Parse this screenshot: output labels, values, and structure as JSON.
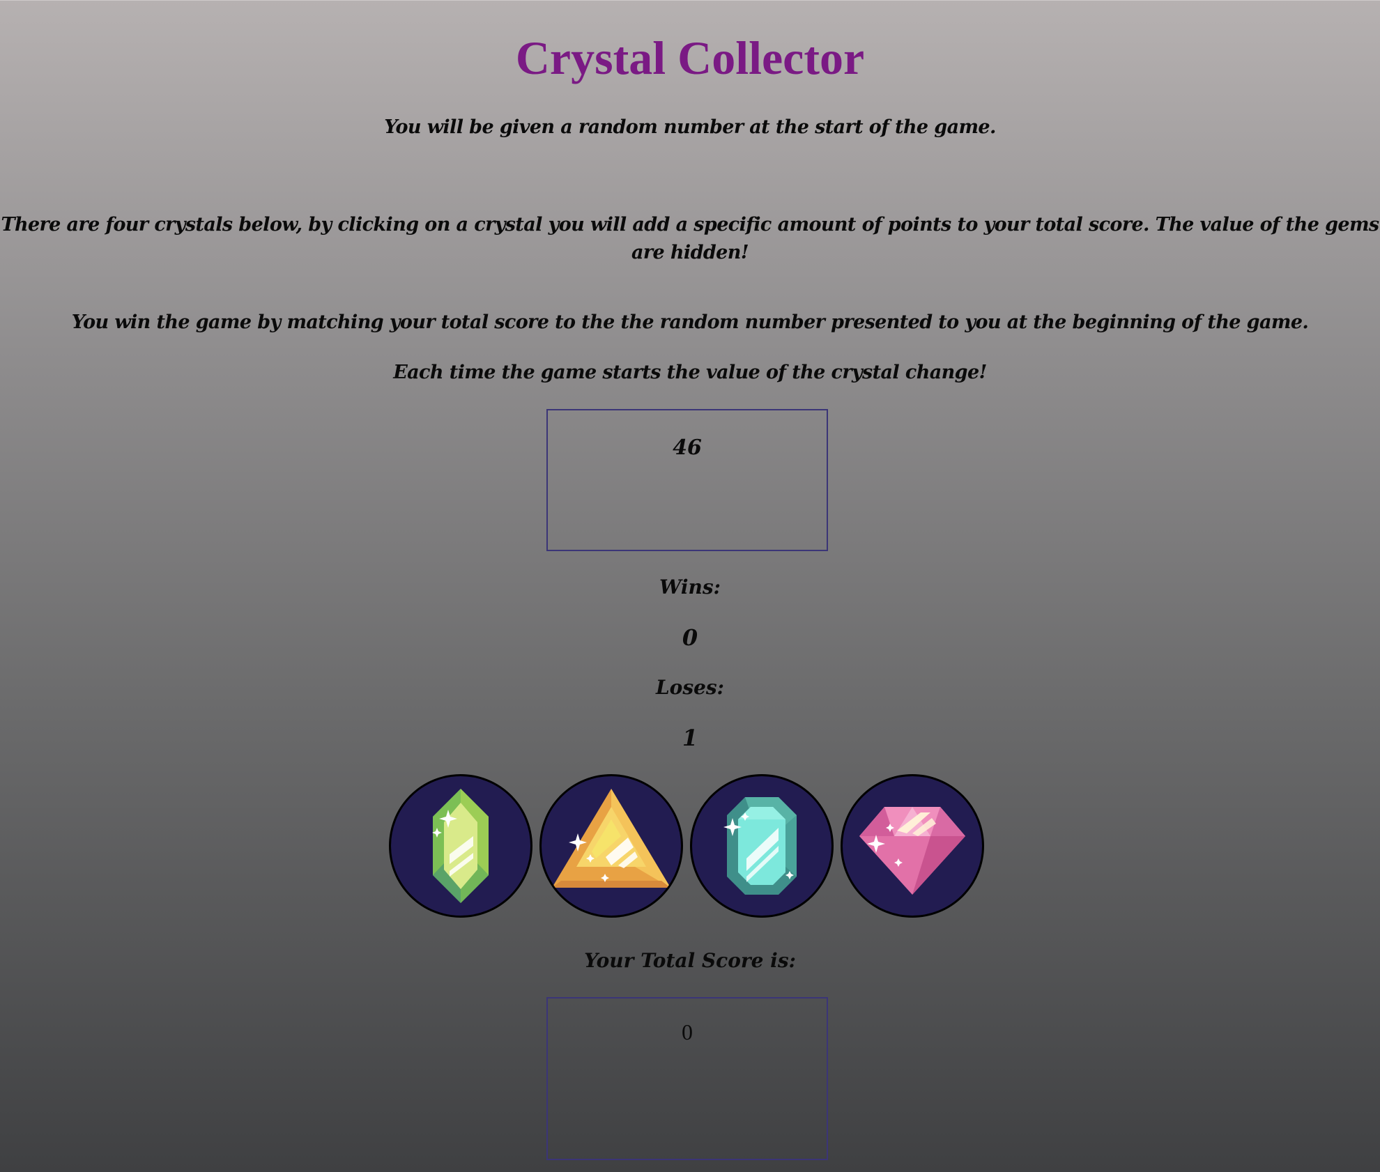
{
  "title": "Crystal Collector",
  "instructions": [
    "You will be given a random number at the start of the game.",
    "There are four crystals below, by clicking on a crystal you will add a specific amount of points to your total score. The value of the gems are hidden!",
    "You win the game by matching your total score to the the random number presented to you at the beginning of the game.",
    "Each time the game starts the value of the crystal change!"
  ],
  "target_number": "46",
  "wins_label": "Wins:",
  "wins": "0",
  "loses_label": "Loses:",
  "loses": "1",
  "score_label": "Your Total Score is:",
  "total_score": "0",
  "crystals": [
    {
      "icon": "green-crystal-icon",
      "color": "#8ec45a"
    },
    {
      "icon": "orange-triangle-crystal-icon",
      "color": "#f2b84f"
    },
    {
      "icon": "teal-crystal-icon",
      "color": "#6fd6c6"
    },
    {
      "icon": "pink-diamond-icon",
      "color": "#ea7bb0"
    }
  ],
  "colors": {
    "title": "#7a1a84",
    "crystal_background": "#221c51",
    "box_border": "#3b3577"
  }
}
